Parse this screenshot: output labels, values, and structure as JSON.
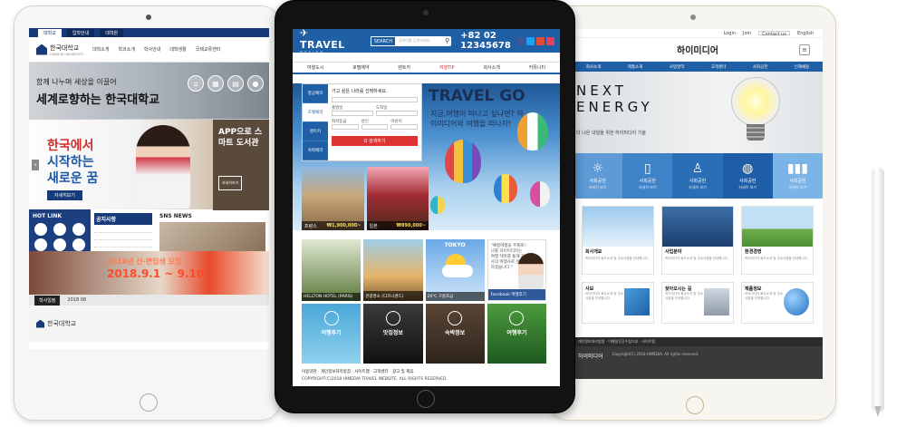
{
  "left": {
    "topbar": [
      "대학교",
      "입학안내",
      "대학원"
    ],
    "logo": "한국대학교",
    "logo_en": "HANGUK UNIVERSITY",
    "nav": [
      "대학소개",
      "학과소개",
      "학사안내",
      "대학생활",
      "국제교류센터"
    ],
    "slogan_small": "함께 나누며 세상을 이끌어",
    "slogan_big": "세계로향하는 한국대학교",
    "banner_line1": "한국에서",
    "banner_line2": "시작하는",
    "banner_line3": "새로운 꿈",
    "banner_btn": "자세히보기",
    "app_text": "APP으로 스마트 도서관",
    "app_btn": "자세히보기",
    "hotlink": "HOT LINK",
    "notice": "공지사항",
    "sns": "SNS NEWS",
    "event_line1": "2018년 신·편입생 모집",
    "event_line2": "2018.9.1 ~ 9.10",
    "foot_tab": "학사일정",
    "foot_month": "2018 08",
    "footer_logo": "한국대학교"
  },
  "middle": {
    "logo": "TRAVEL",
    "logo_sub": "DESIGN",
    "search_label": "SEARCH",
    "search_placeholder": "검색어를 입력하세요",
    "phone": "+82 02 12345678",
    "nav": [
      "여행도시",
      "호텔예약",
      "렌트카",
      "여행TIP",
      "회사소개",
      "커뮤니티"
    ],
    "tabs": [
      "항공예약",
      "호텔예약",
      "렌트카",
      "숙박예약"
    ],
    "form_q": "가고 싶은 나라를 선택하세요.",
    "form_labels": [
      "출발일",
      "도착일",
      "좌석등급",
      "성인",
      "어린이"
    ],
    "form_btn": "Q 검색하기",
    "title": "TRAVEL GO",
    "subtitle": "지금,여행이 떠나고 싶나면? 하이미디어와 여행을 떠나자!",
    "photo1_name": "프랑스",
    "photo1_price": "₩1,900,000~",
    "photo2_name": "일본",
    "photo2_price": "₩890,000~",
    "grid1": "HELLTON HOTEL (PARIS)",
    "grid2": "관광명소 (디즈니랜드)",
    "tokyo": "TOKYO",
    "tokyo_temp": "20℃ 구름조금",
    "fb_text": "\"예정여행을 주제로!나를 하이미디어는 여행 테마를 통해 자사의 여행사로 성장하겠습니다.\"",
    "fb_bar": "Facebook 여행후기",
    "row3_1": "여행후기",
    "row3_2": "맛집정보",
    "row3_3": "숙박정보",
    "row3_4": "여행후기",
    "footer_links": "이용약관 · 개인정보처리방침 · 사이트맵 · 고객센터 · 광고 및 제휴",
    "footer_addr": "COPYRIGHT(C)2018 HIMEDIA TRAVEL WEBSITE. ALL RIGHTS RESERVED."
  },
  "right": {
    "top_links": [
      "Login",
      "Join",
      "Contact us",
      "English"
    ],
    "title": "하이미디어",
    "nav": [
      "회사소개",
      "제품소개",
      "사업영역",
      "고객센터",
      "사회공헌",
      "인재채용"
    ],
    "hero1": "NEXT",
    "hero2": "ENERGY",
    "hero_sub": "더 나은 내일을 위한 하이미디어 기술",
    "tiles": [
      "사회공헌",
      "사회공헌",
      "사회공헌",
      "사회공헌",
      "사회공헌"
    ],
    "tile_sub": "자세히 보기",
    "card1_h": "회사개요",
    "card2_h": "사업분야",
    "card3_h": "환경경영",
    "card_d": "하이미디어 회사소개 및 주요사업을 안내합니다.",
    "card4_h": "사보",
    "card5_h": "찾아오시는 길",
    "card6_h": "제품정보",
    "more": "바로가기 >",
    "foot_links": "개인정보처리방침 · 이메일무단수집거부 · 사이트맵",
    "foot_logo": "하이미디어",
    "foot_copy": "Copyright(C) 2018 HIMEDIA. All rights reserved."
  },
  "colors": {
    "uni_blue": "#183a78",
    "travel_blue": "#1f5fa5",
    "tile_colors": [
      "#5d9ad6",
      "#3e83c7",
      "#2a6eb6",
      "#1e5ea6",
      "#7bb4e6"
    ]
  }
}
